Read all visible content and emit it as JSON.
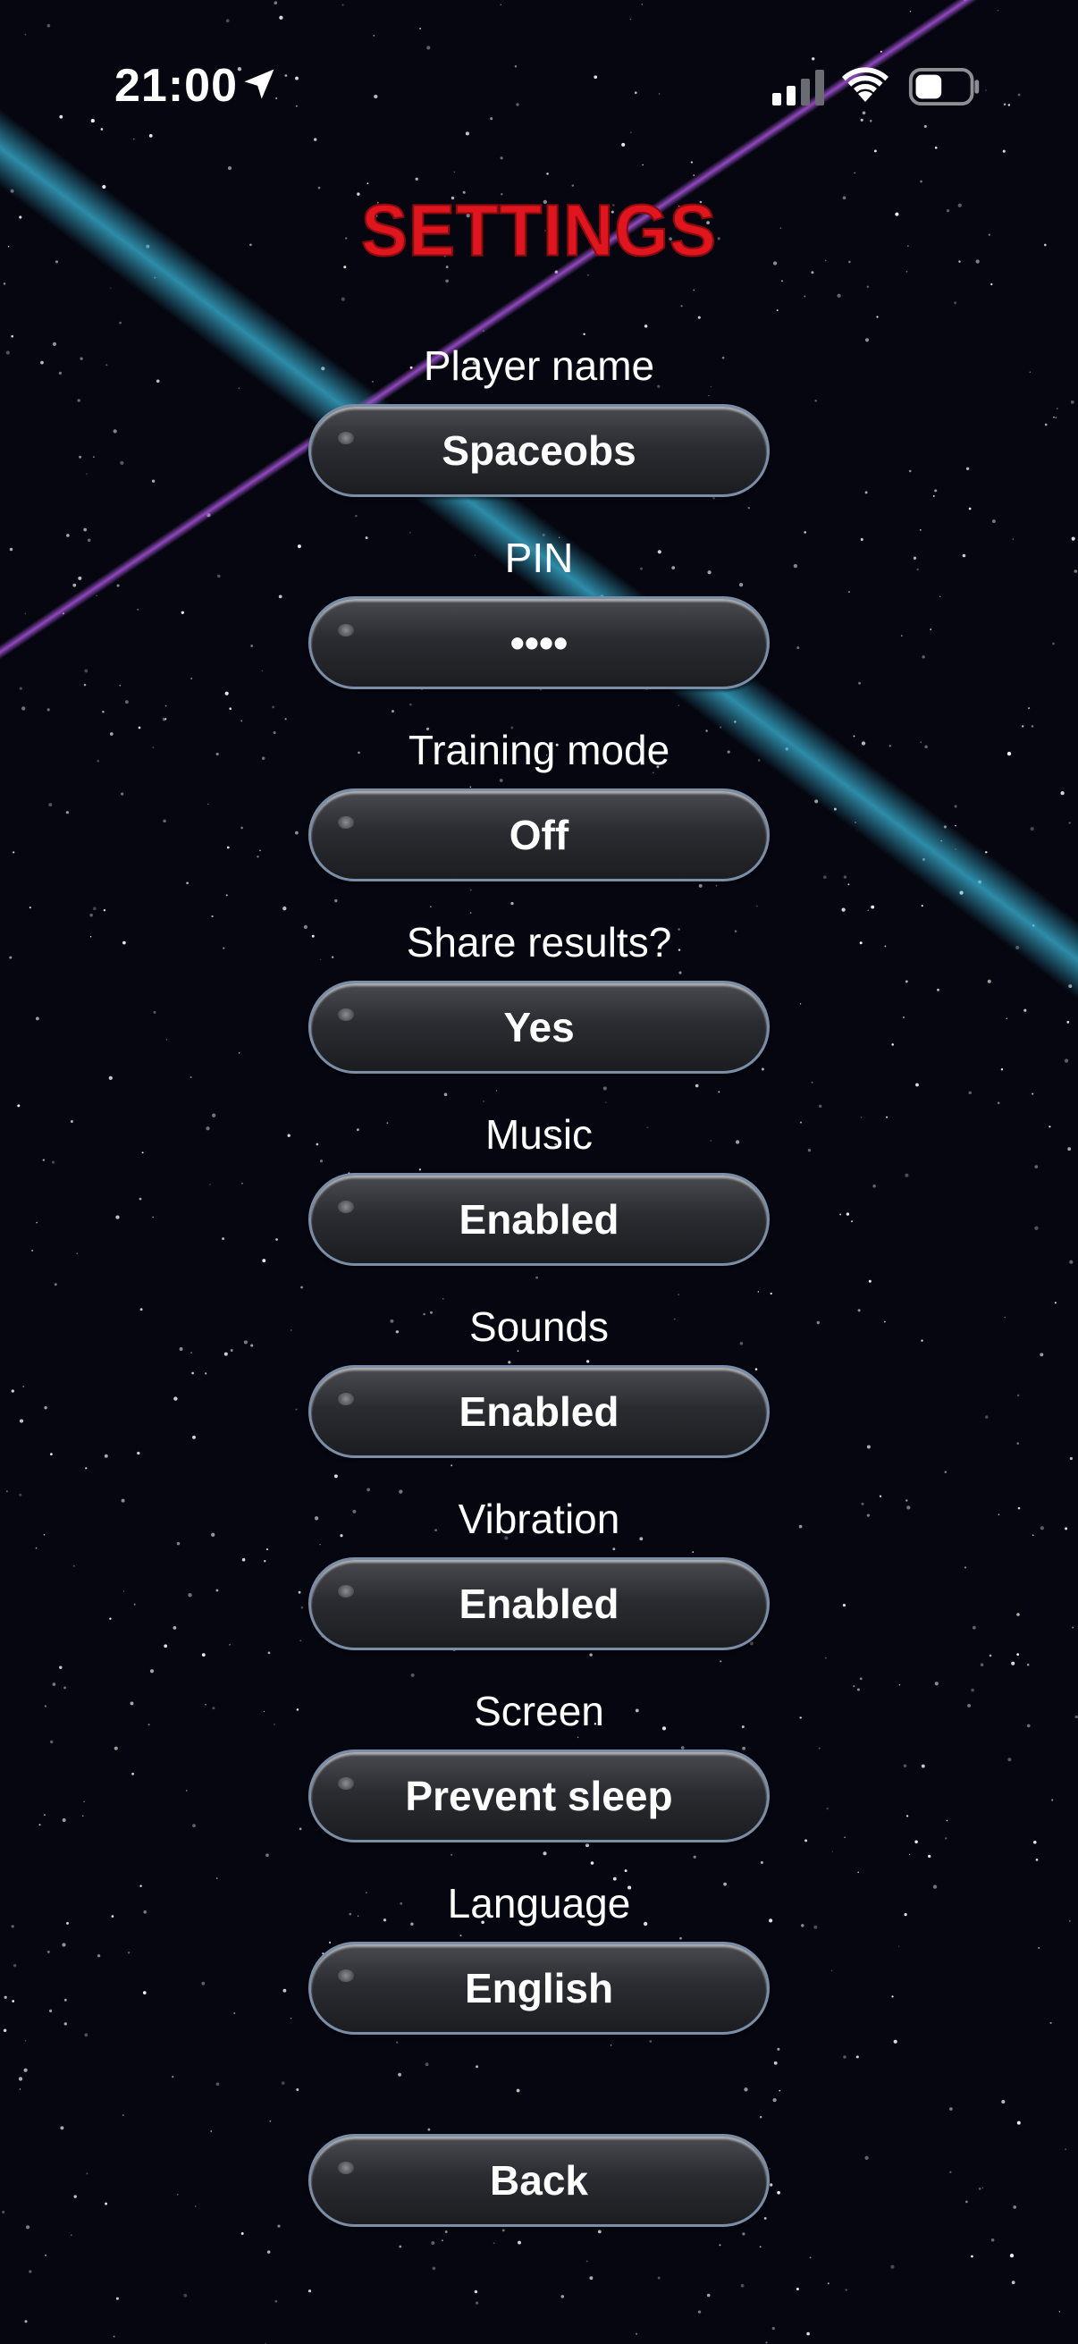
{
  "status_bar": {
    "time": "21:00",
    "icons": [
      "location-arrow-icon",
      "cellular-signal-icon",
      "wifi-icon",
      "battery-icon"
    ]
  },
  "title": "SETTINGS",
  "settings": [
    {
      "label": "Player name",
      "value": "Spaceobs"
    },
    {
      "label": "PIN",
      "value": "••••"
    },
    {
      "label": "Training mode",
      "value": "Off"
    },
    {
      "label": "Share results?",
      "value": "Yes"
    },
    {
      "label": "Music",
      "value": "Enabled"
    },
    {
      "label": "Sounds",
      "value": "Enabled"
    },
    {
      "label": "Vibration",
      "value": "Enabled"
    },
    {
      "label": "Screen",
      "value": "Prevent sleep"
    },
    {
      "label": "Language",
      "value": "English"
    }
  ],
  "back_label": "Back",
  "colors": {
    "background": "#05060f",
    "title": "#e0151d",
    "beam_cyan": "#3cb9dc",
    "beam_purple": "#a050d2",
    "pill_border": "#7a8ea8"
  }
}
